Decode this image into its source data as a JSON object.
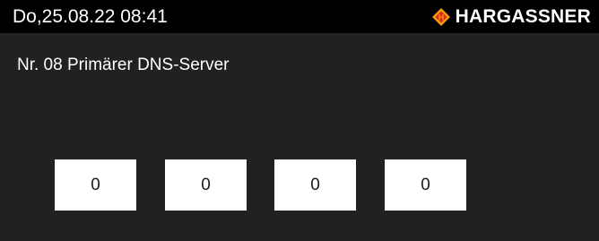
{
  "header": {
    "datetime": "Do,25.08.22 08:41",
    "brand_name": "HARGASSNER",
    "logo_letter": "H",
    "logo_icon": "hargassner-diamond-logo"
  },
  "main": {
    "title": "Nr. 08 Primärer DNS-Server",
    "octets": [
      "0",
      "0",
      "0",
      "0"
    ]
  },
  "colors": {
    "background": "#222020",
    "top_bar": "#000000",
    "text": "#ffffff",
    "field_background": "#ffffff",
    "field_text": "#1a1a1a",
    "logo_orange": "#f59a0a",
    "logo_red": "#d8261b"
  }
}
